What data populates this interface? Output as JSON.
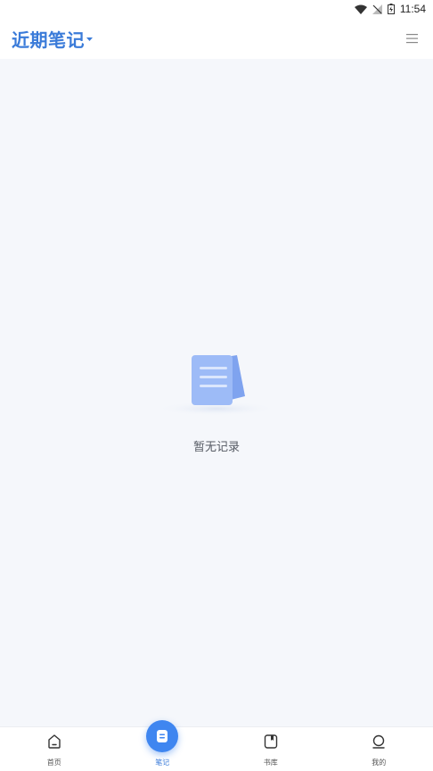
{
  "status_bar": {
    "time": "11:54"
  },
  "header": {
    "title": "近期笔记",
    "title_icon": "caret-down-icon",
    "menu_icon": "hamburger-menu-icon"
  },
  "empty_state": {
    "message": "暂无记录"
  },
  "tabbar": {
    "items": [
      {
        "label": "首页",
        "icon": "home-icon"
      },
      {
        "label": "笔记",
        "icon": "note-icon",
        "active": true
      },
      {
        "label": "书库",
        "icon": "book-icon"
      },
      {
        "label": "我的",
        "icon": "profile-icon"
      }
    ]
  },
  "colors": {
    "accent": "#3a7bd9",
    "background": "#f5f7fb"
  }
}
